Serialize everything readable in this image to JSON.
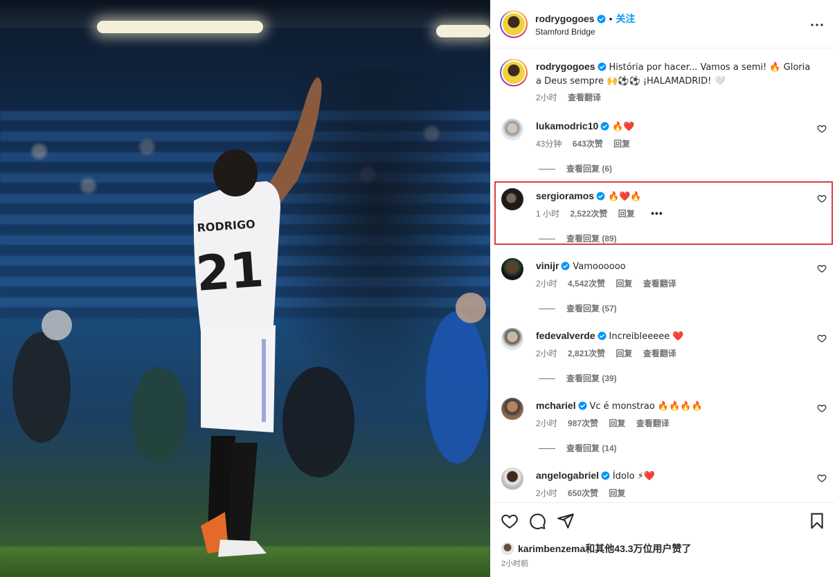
{
  "post": {
    "author": "rodrygogoes",
    "follow_label": "关注",
    "location": "Stamford Bridge",
    "caption_user": "rodrygogoes",
    "caption_text": "História por hacer... Vamos a semi! 🔥 Gloria a Deus sempre 🙌⚽⚽ ¡HALAMADRID! 🤍",
    "caption_time": "2小时",
    "caption_translate": "查看翻译"
  },
  "comments": [
    {
      "user": "lukamodric10",
      "text": "🔥❤️",
      "time": "43分钟",
      "likes": "643次赞",
      "reply": "回复",
      "translate": "",
      "view_replies": "查看回复 (6)"
    },
    {
      "user": "sergioramos",
      "text": "🔥❤️🔥",
      "time": "1 小时",
      "likes": "2,522次赞",
      "reply": "回复",
      "translate": "",
      "more": "•••",
      "view_replies": "查看回复 (89)"
    },
    {
      "user": "vinijr",
      "text": "Vamoooooo",
      "time": "2小时",
      "likes": "4,542次赞",
      "reply": "回复",
      "translate": "查看翻译",
      "view_replies": "查看回复 (57)"
    },
    {
      "user": "fedevalverde",
      "text": "Increibleeeee ❤️",
      "time": "2小时",
      "likes": "2,821次赞",
      "reply": "回复",
      "translate": "查看翻译",
      "view_replies": "查看回复 (39)"
    },
    {
      "user": "mchariel",
      "text": "Vc é monstrao 🔥🔥🔥🔥",
      "time": "2小时",
      "likes": "987次赞",
      "reply": "回复",
      "translate": "查看翻译",
      "view_replies": "查看回复 (14)"
    },
    {
      "user": "angelogabriel",
      "text": "Ídolo ⚡❤️",
      "time": "2小时",
      "likes": "650次赞",
      "reply": "回复",
      "translate": "",
      "view_replies": ""
    }
  ],
  "footer": {
    "liked_by_user": "karimbenzema",
    "liked_by_rest": "和其他43.3万位用户赞了",
    "time_ago": "2小时前"
  },
  "icons": {
    "like": "heart-icon",
    "comment": "comment-icon",
    "share": "share-icon",
    "save": "bookmark-icon",
    "more": "more-icon",
    "verified": "verified-badge-icon"
  },
  "colors": {
    "verified": "#0095f6",
    "follow": "#0095f6",
    "highlight_box": "#e03b3b"
  }
}
